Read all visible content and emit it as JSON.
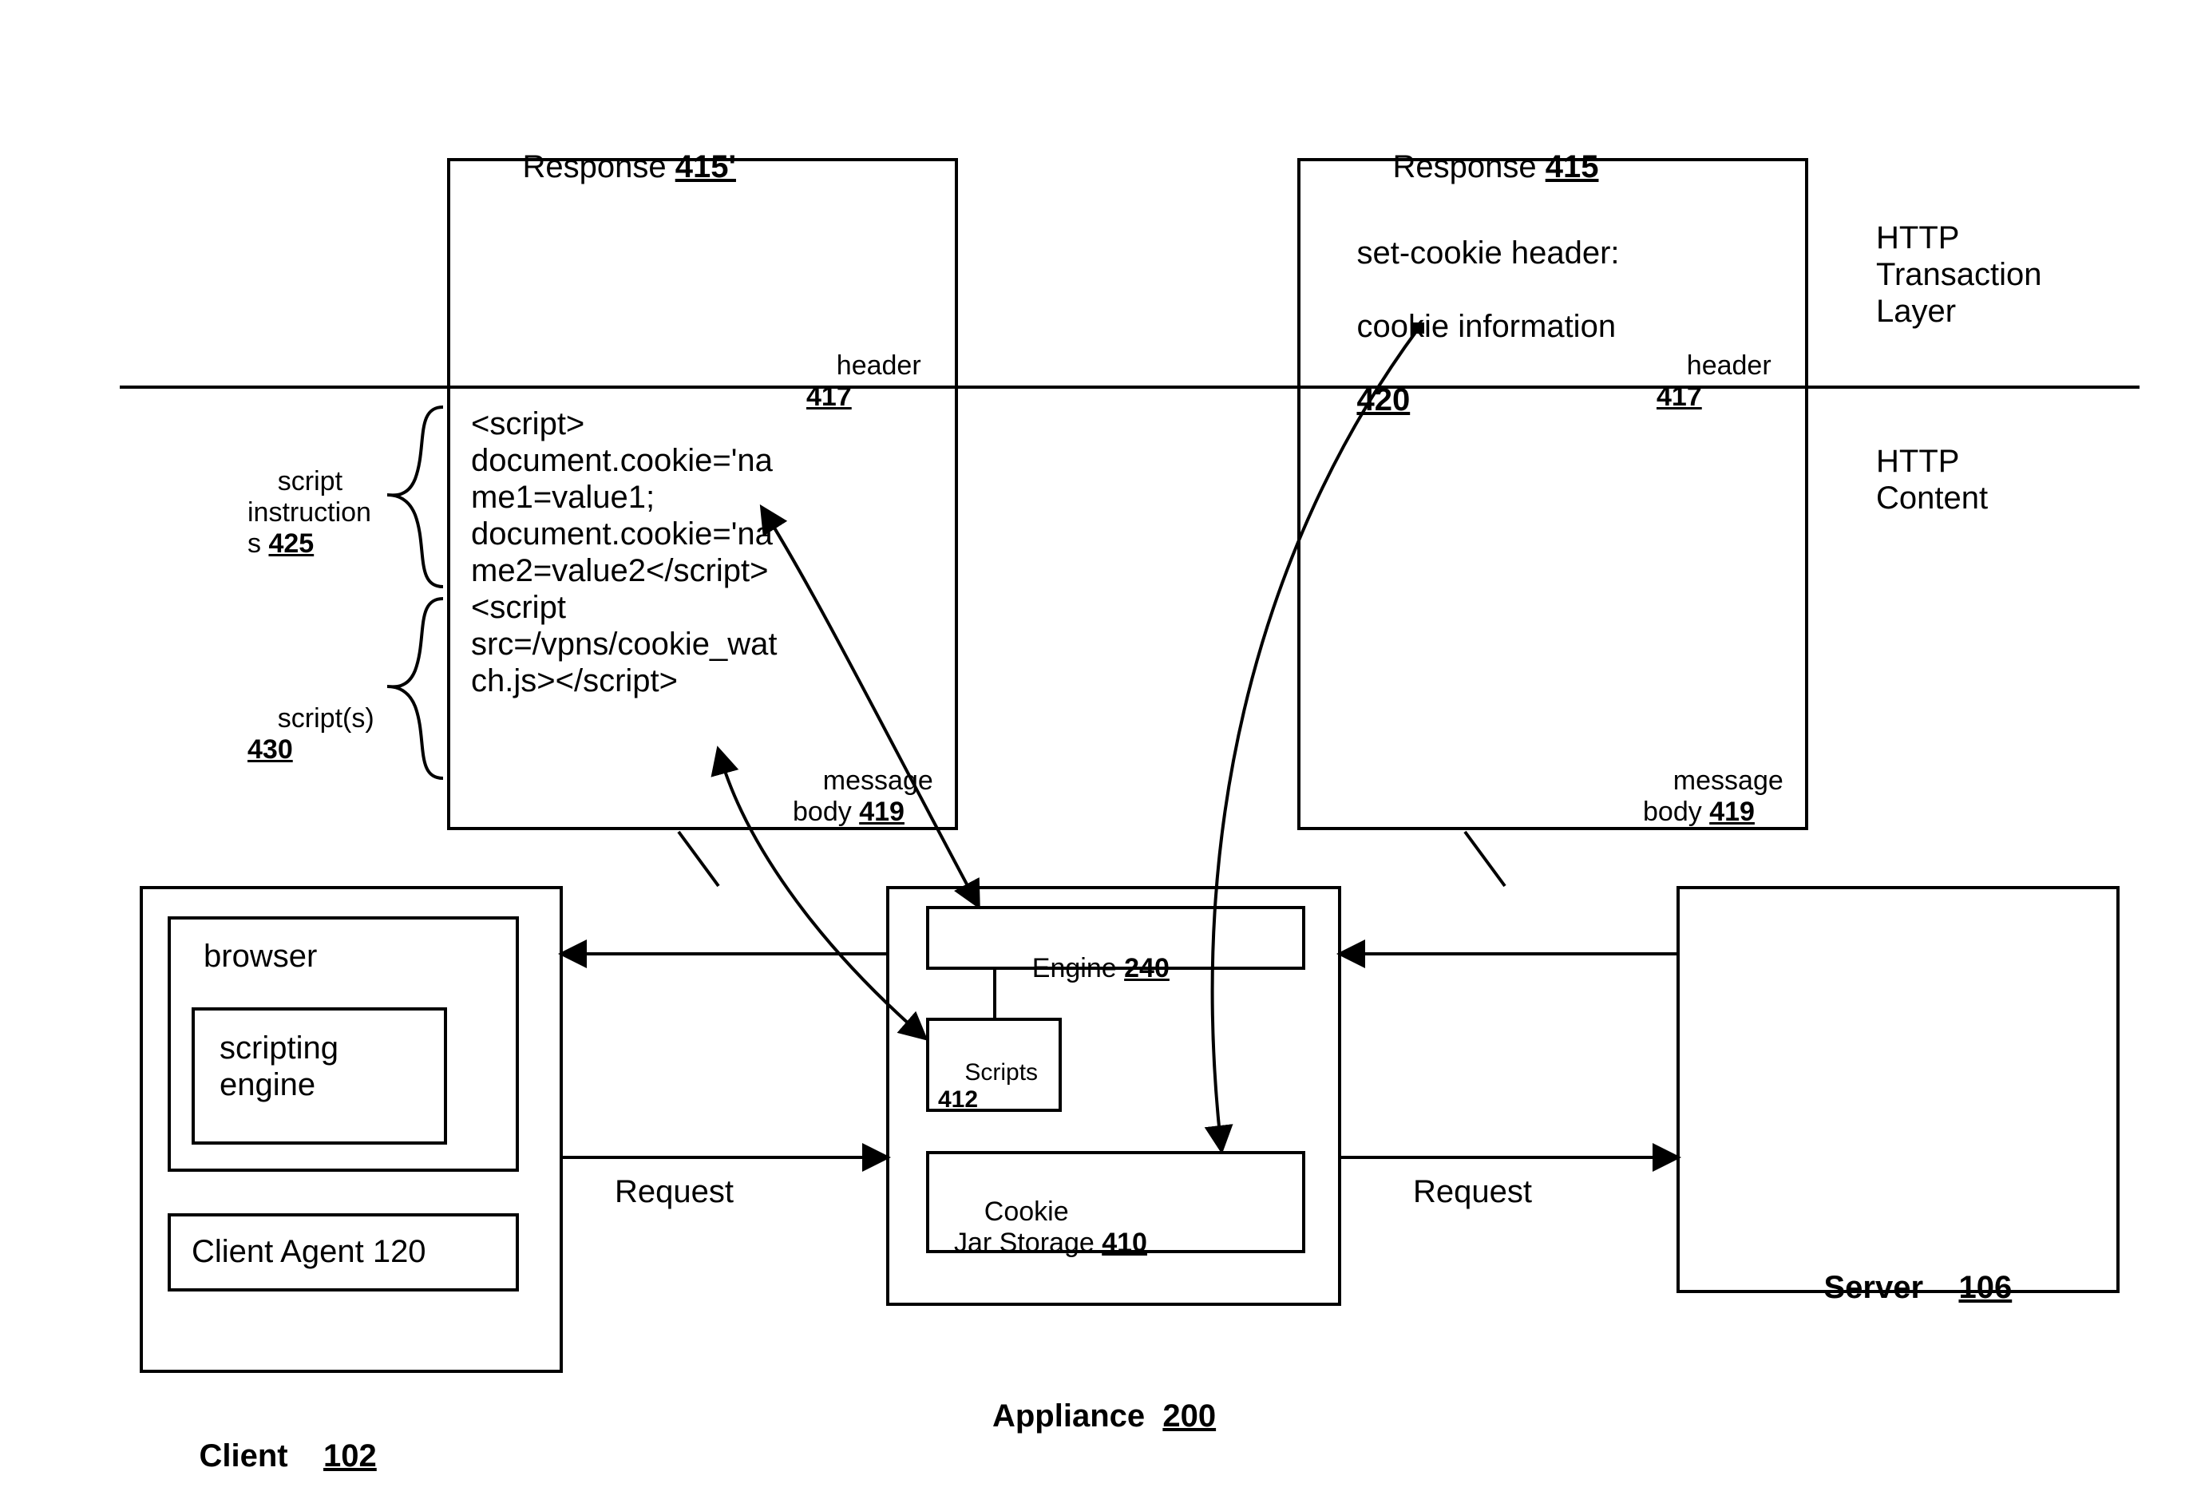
{
  "titles": {
    "response_prime_word": "Response",
    "response_prime_num": "415'",
    "response_word": "Response",
    "response_num": "415"
  },
  "layers": {
    "transaction": "HTTP\nTransaction\nLayer",
    "content": "HTTP\nContent"
  },
  "header_label_word": "header",
  "header_label_num": "417",
  "message_body_word": "message\nbody",
  "message_body_num": "419",
  "set_cookie": {
    "line1": "set-cookie header:",
    "line2": "cookie information",
    "num": "420"
  },
  "script_instructions_label_word": "script\ninstruction\ns",
  "script_instructions_num": "425",
  "scripts_label_word": "script(s)",
  "scripts_label_num": "430",
  "script_block": "<script>\ndocument.cookie='na\nme1=value1;\ndocument.cookie='na\nme2=value2</script>\n<script\nsrc=/vpns/cookie_wat\nch.js></script>",
  "engine_word": "Engine",
  "engine_num": "240",
  "scripts_box_word": "Scripts",
  "scripts_box_num": "412",
  "cookie_jar_word": "Cookie\nJar Storage",
  "cookie_jar_num": "410",
  "browser_word": "browser",
  "scripting_engine_word": "scripting\nengine",
  "client_agent_word": "Client Agent 120",
  "request_word": "Request",
  "client_word": "Client",
  "client_num": "102",
  "appliance_word": "Appliance",
  "appliance_num": "200",
  "server_word": "Server",
  "server_num": "106"
}
